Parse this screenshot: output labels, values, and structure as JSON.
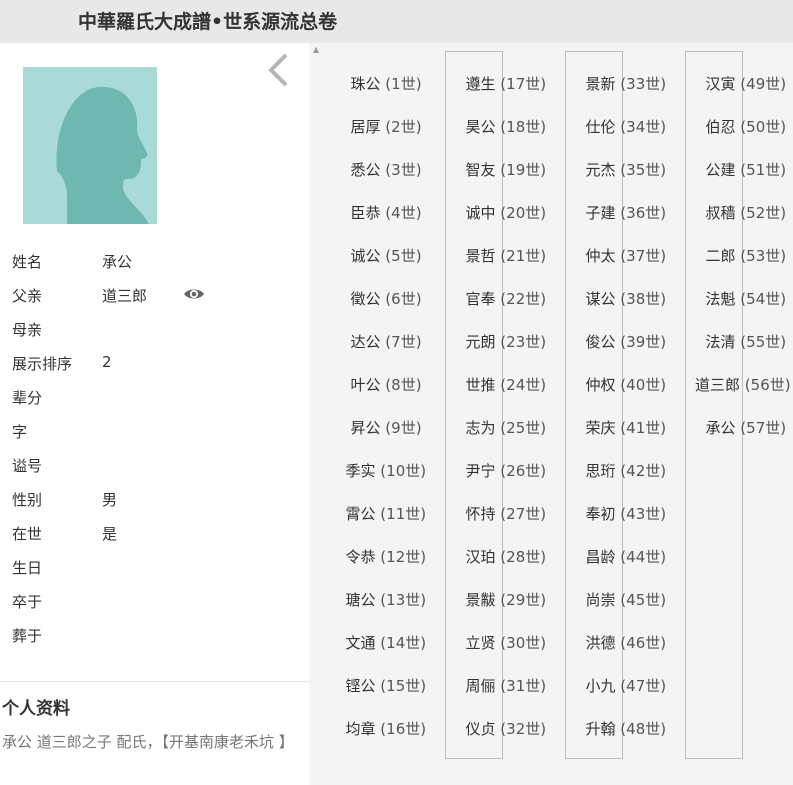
{
  "header": {
    "title": "中華羅氏大成譜•世系源流总卷"
  },
  "profile": {
    "fields": [
      {
        "label": "姓名",
        "value": "承公"
      },
      {
        "label": "父亲",
        "value": "道三郎"
      },
      {
        "label": "母亲",
        "value": ""
      },
      {
        "label": "展示排序",
        "value": "2"
      },
      {
        "label": "辈分",
        "value": ""
      },
      {
        "label": "字",
        "value": ""
      },
      {
        "label": "谥号",
        "value": ""
      },
      {
        "label": "性别",
        "value": "男"
      },
      {
        "label": "在世",
        "value": "是"
      },
      {
        "label": "生日",
        "value": ""
      },
      {
        "label": "卒于",
        "value": ""
      },
      {
        "label": "葬于",
        "value": ""
      }
    ],
    "icons": {
      "back": "chevron-left-icon",
      "view": "eye-icon",
      "avatar": "person-silhouette-icon"
    }
  },
  "personal": {
    "title": "个人资料",
    "bio": "承公  道三郎之子   配氏，【开基南康老禾坑 】"
  },
  "generations": [
    {
      "name": "珠公",
      "gen": "(1世)"
    },
    {
      "name": "居厚",
      "gen": "(2世)"
    },
    {
      "name": "悉公",
      "gen": "(3世)"
    },
    {
      "name": "臣恭",
      "gen": "(4世)"
    },
    {
      "name": "诚公",
      "gen": "(5世)"
    },
    {
      "name": "徵公",
      "gen": "(6世)"
    },
    {
      "name": "达公",
      "gen": "(7世)"
    },
    {
      "name": "叶公",
      "gen": "(8世)"
    },
    {
      "name": "昇公",
      "gen": "(9世)"
    },
    {
      "name": "季实",
      "gen": "(10世)"
    },
    {
      "name": "霄公",
      "gen": "(11世)"
    },
    {
      "name": "令恭",
      "gen": "(12世)"
    },
    {
      "name": "瑭公",
      "gen": "(13世)"
    },
    {
      "name": "文通",
      "gen": "(14世)"
    },
    {
      "name": "铿公",
      "gen": "(15世)"
    },
    {
      "name": "均章",
      "gen": "(16世)"
    },
    {
      "name": "遵生",
      "gen": "(17世)"
    },
    {
      "name": "昊公",
      "gen": "(18世)"
    },
    {
      "name": "智友",
      "gen": "(19世)"
    },
    {
      "name": "诚中",
      "gen": "(20世)"
    },
    {
      "name": "景哲",
      "gen": "(21世)"
    },
    {
      "name": "官奉",
      "gen": "(22世)"
    },
    {
      "name": "元朗",
      "gen": "(23世)"
    },
    {
      "name": "世推",
      "gen": "(24世)"
    },
    {
      "name": "志为",
      "gen": "(25世)"
    },
    {
      "name": "尹宁",
      "gen": "(26世)"
    },
    {
      "name": "怀持",
      "gen": "(27世)"
    },
    {
      "name": "汉珀",
      "gen": "(28世)"
    },
    {
      "name": "景黻",
      "gen": "(29世)"
    },
    {
      "name": "立贤",
      "gen": "(30世)"
    },
    {
      "name": "周俪",
      "gen": "(31世)"
    },
    {
      "name": "仪贞",
      "gen": "(32世)"
    },
    {
      "name": "景新",
      "gen": "(33世)"
    },
    {
      "name": "仕伦",
      "gen": "(34世)"
    },
    {
      "name": "元杰",
      "gen": "(35世)"
    },
    {
      "name": "子建",
      "gen": "(36世)"
    },
    {
      "name": "仲太",
      "gen": "(37世)"
    },
    {
      "name": "谋公",
      "gen": "(38世)"
    },
    {
      "name": "俊公",
      "gen": "(39世)"
    },
    {
      "name": "仲权",
      "gen": "(40世)"
    },
    {
      "name": "荣庆",
      "gen": "(41世)"
    },
    {
      "name": "思珩",
      "gen": "(42世)"
    },
    {
      "name": "奉初",
      "gen": "(43世)"
    },
    {
      "name": "昌龄",
      "gen": "(44世)"
    },
    {
      "name": "尚崇",
      "gen": "(45世)"
    },
    {
      "name": "洪德",
      "gen": "(46世)"
    },
    {
      "name": "小九",
      "gen": "(47世)"
    },
    {
      "name": "升翰",
      "gen": "(48世)"
    },
    {
      "name": "汉寅",
      "gen": "(49世)"
    },
    {
      "name": "伯忍",
      "gen": "(50世)"
    },
    {
      "name": "公建",
      "gen": "(51世)"
    },
    {
      "name": "叔穑",
      "gen": "(52世)"
    },
    {
      "name": "二郎",
      "gen": "(53世)"
    },
    {
      "name": "法魁",
      "gen": "(54世)"
    },
    {
      "name": "法清",
      "gen": "(55世)"
    },
    {
      "name": "道三郎",
      "gen": "(56世)"
    },
    {
      "name": "承公",
      "gen": "(57世)"
    }
  ],
  "colors": {
    "avatar_bg": "#a9dad8",
    "avatar_figure": "#6fb7b1",
    "header_bg": "#e8e8e8",
    "panel_bg": "#f4f4f4"
  }
}
